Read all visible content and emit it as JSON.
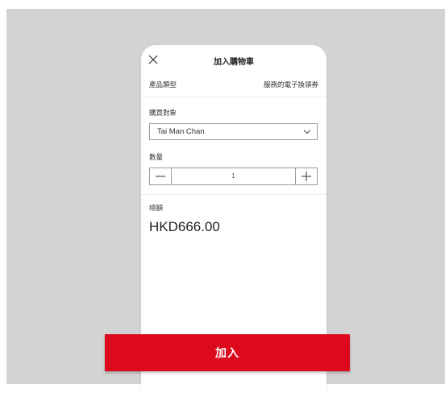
{
  "header": {
    "title": "加入購物車",
    "close_icon": "close-icon"
  },
  "product": {
    "type_label": "產品類型",
    "type_value": "服務的電子換領券"
  },
  "recipient": {
    "label": "購買對象",
    "selected": "Tai Man Chan",
    "chevron_icon": "chevron-down-icon"
  },
  "quantity": {
    "label": "數量",
    "value": "1",
    "minus_icon": "minus-icon",
    "plus_icon": "plus-icon"
  },
  "total": {
    "label": "總額",
    "value": "HKD666.00"
  },
  "actions": {
    "add_label": "加入"
  },
  "colors": {
    "accent": "#dd0a1e",
    "backdrop": "#d3d3d3",
    "border": "#9a9a9a"
  }
}
